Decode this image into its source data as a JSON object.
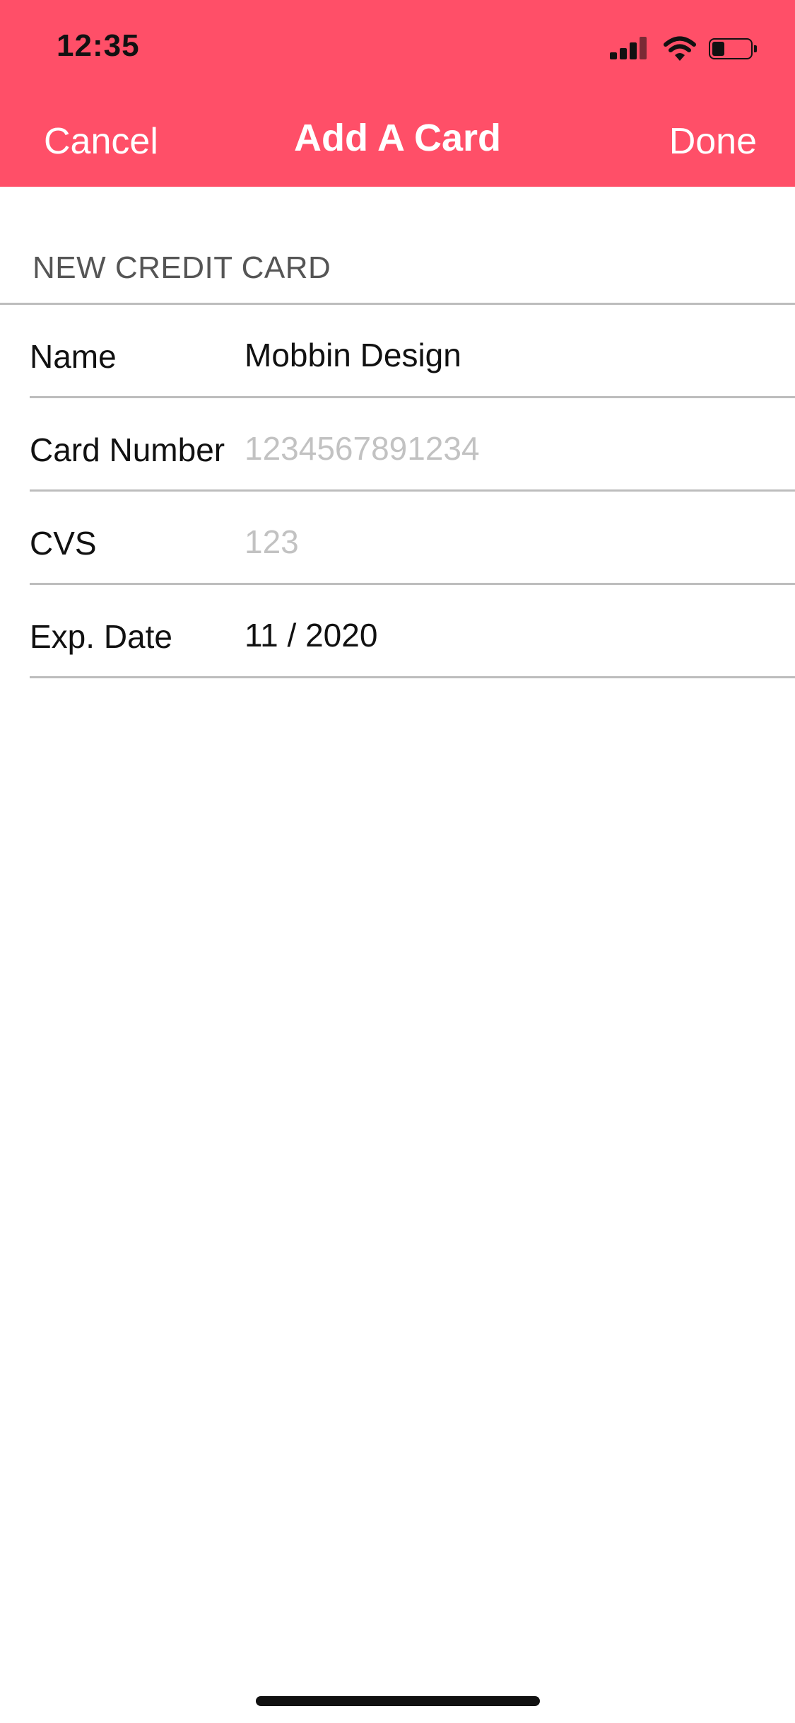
{
  "status_bar": {
    "time": "12:35",
    "signal_icon": "cellular-signal-icon",
    "wifi_icon": "wifi-icon",
    "battery_icon": "battery-icon",
    "battery_level": 0.25
  },
  "nav": {
    "cancel_label": "Cancel",
    "title": "Add A Card",
    "done_label": "Done",
    "background_color": "#ff4f68"
  },
  "section": {
    "header": "NEW CREDIT CARD"
  },
  "form": {
    "name": {
      "label": "Name",
      "value": "Mobbin Design",
      "placeholder": ""
    },
    "card_number": {
      "label": "Card Number",
      "value": "",
      "placeholder": "1234567891234"
    },
    "cvs": {
      "label": "CVS",
      "value": "",
      "placeholder": "123"
    },
    "exp_date": {
      "label": "Exp. Date",
      "value": "11 / 2020",
      "placeholder": ""
    }
  }
}
